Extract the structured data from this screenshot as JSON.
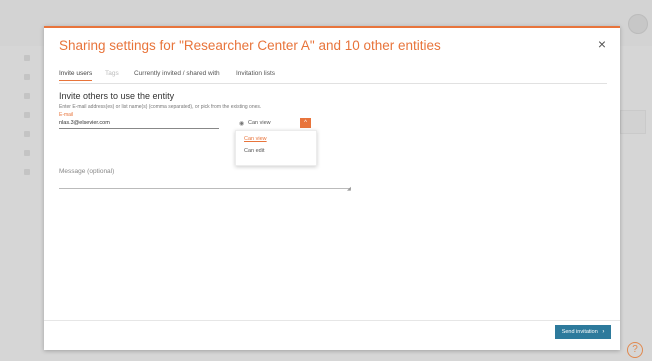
{
  "dialog": {
    "title": "Sharing settings for \"Researcher Center A\" and 10 other entities",
    "close_symbol": "×",
    "accent_color": "#e8743b"
  },
  "tabs": [
    {
      "label": "Invite users",
      "active": true
    },
    {
      "label": "Tags",
      "active": false
    },
    {
      "label": "Currently invited / shared with",
      "active": false
    },
    {
      "label": "Invitation lists",
      "active": false
    }
  ],
  "invite": {
    "heading": "Invite others to use the entity",
    "instructions": "Enter E-mail address(es) or list name(s) (comma separated), or pick from the existing ones.",
    "email_label": "E-mail",
    "email_value": "nlas.3@elsevier.com"
  },
  "permission": {
    "icon": "eye-icon",
    "current": "Can view",
    "toggle_symbol": "^",
    "options": [
      "Can view",
      "Can edit"
    ]
  },
  "message": {
    "label": "Message (optional)",
    "resize_symbol": "◢"
  },
  "footer": {
    "send_label": "Send invitation",
    "send_color": "#2d7a9c",
    "chevron": "›"
  },
  "background": {
    "help_symbol": "?"
  }
}
